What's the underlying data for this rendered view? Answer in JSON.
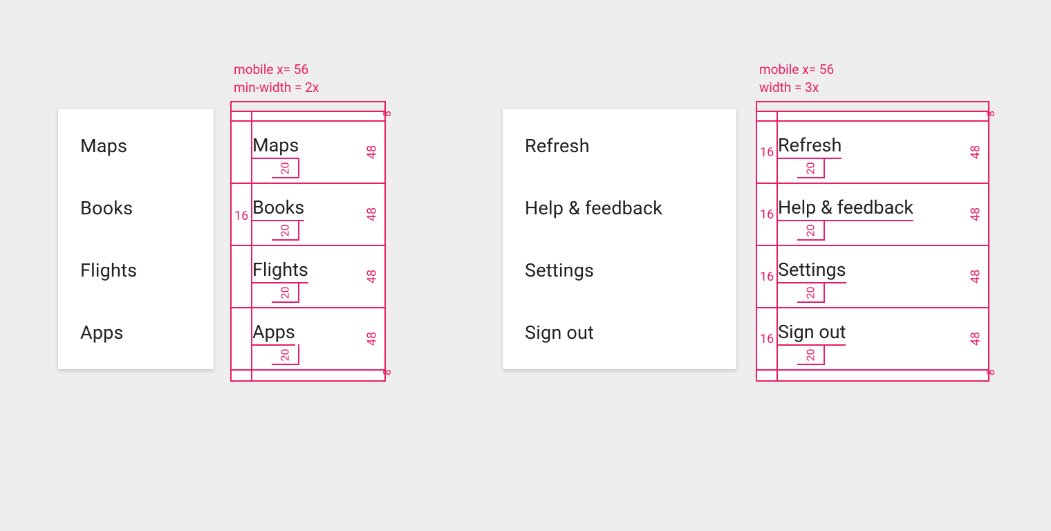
{
  "accent": "#e91e63",
  "left_menu": {
    "items": [
      "Maps",
      "Books",
      "Flights",
      "Apps"
    ]
  },
  "right_menu": {
    "items": [
      "Refresh",
      "Help & feedback",
      "Settings",
      "Sign out"
    ]
  },
  "spec_left": {
    "header_line1": "mobile x= 56",
    "header_line2": "min-width = 2x",
    "left_pad": "16",
    "row_height": "48",
    "text_bottom": "20",
    "pad": "8",
    "items": [
      "Maps",
      "Books",
      "Flights",
      "Apps"
    ]
  },
  "spec_right": {
    "header_line1": "mobile x= 56",
    "header_line2": "width = 3x",
    "left_pad": "16",
    "row_height": "48",
    "text_bottom": "20",
    "pad": "8",
    "items": [
      "Refresh",
      "Help & feedback",
      "Settings",
      "Sign out"
    ]
  }
}
